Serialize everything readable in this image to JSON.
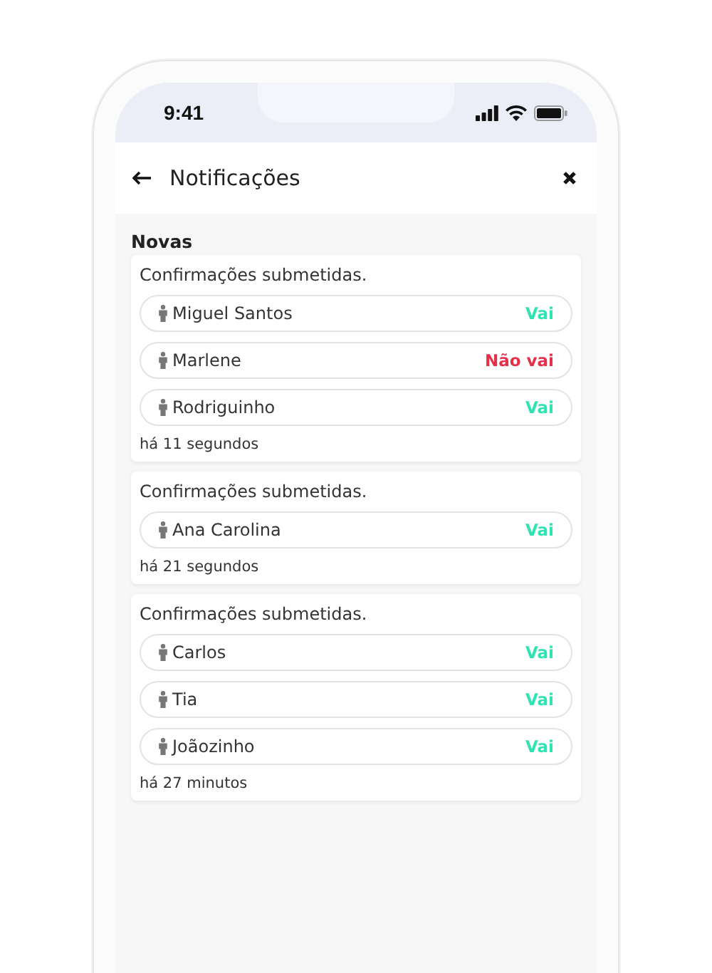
{
  "status_bar": {
    "time": "9:41"
  },
  "header": {
    "title": "Notificações"
  },
  "section_title": "Novas",
  "notifications": [
    {
      "message": "Confirmações submetidas.",
      "time": "há 11 segundos",
      "responses": [
        {
          "name": "Miguel Santos",
          "answer": "Vai",
          "kind": "yes"
        },
        {
          "name": "Marlene",
          "answer": "Não vai",
          "kind": "no"
        },
        {
          "name": "Rodriguinho",
          "answer": "Vai",
          "kind": "yes"
        }
      ]
    },
    {
      "message": "Confirmações submetidas.",
      "time": "há 21 segundos",
      "responses": [
        {
          "name": "Ana Carolina",
          "answer": "Vai",
          "kind": "yes"
        }
      ]
    },
    {
      "message": "Confirmações submetidas.",
      "time": "há 27 minutos",
      "responses": [
        {
          "name": "Carlos",
          "answer": "Vai",
          "kind": "yes"
        },
        {
          "name": "Tia",
          "answer": "Vai",
          "kind": "yes"
        },
        {
          "name": "Joãozinho",
          "answer": "Vai",
          "kind": "yes"
        }
      ]
    }
  ]
}
